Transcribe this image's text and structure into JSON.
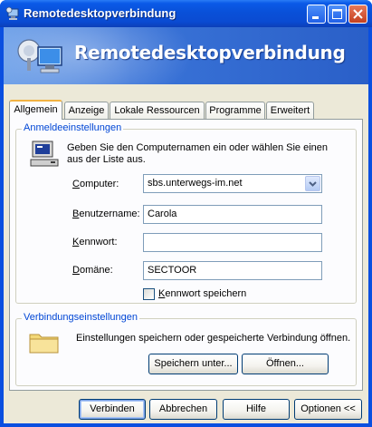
{
  "window": {
    "title": "Remotedesktopverbindung"
  },
  "banner": {
    "title": "Remotedesktopverbindung"
  },
  "tabs": [
    {
      "label": "Allgemein"
    },
    {
      "label": "Anzeige"
    },
    {
      "label": "Lokale Ressourcen"
    },
    {
      "label": "Programme"
    },
    {
      "label": "Erweitert"
    }
  ],
  "logon": {
    "group_label": "Anmeldeeinstellungen",
    "instruction_line1": "Geben Sie den Computernamen ein oder wählen Sie einen",
    "instruction_line2": "aus der Liste aus.",
    "computer_label": "Computer:",
    "computer_value": "sbs.unterwegs-im.net",
    "username_label": "Benutzername:",
    "username_value": "Carola",
    "password_label": "Kennwort:",
    "password_value": "",
    "domain_label": "Domäne:",
    "domain_value": "SECTOOR",
    "save_password_label": "Kennwort speichern",
    "save_password_checked": false
  },
  "connection": {
    "group_label": "Verbindungseinstellungen",
    "instruction": "Einstellungen speichern oder gespeicherte Verbindung öffnen.",
    "save_as_label": "Speichern unter...",
    "open_label": "Öffnen..."
  },
  "footer": {
    "connect_label": "Verbinden",
    "cancel_label": "Abbrechen",
    "help_label": "Hilfe",
    "options_label": "Optionen <<"
  }
}
